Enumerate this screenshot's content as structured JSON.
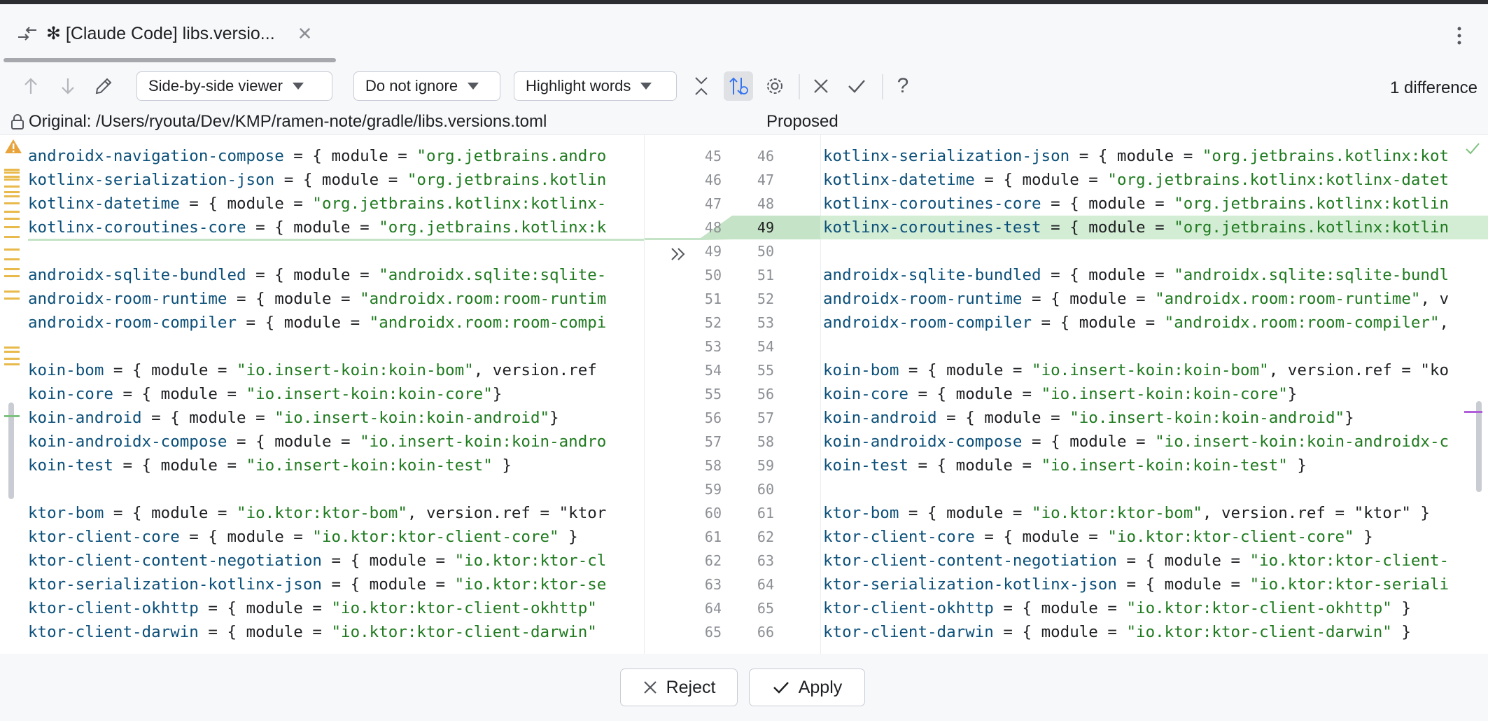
{
  "tab": {
    "title": "✻ [Claude Code] libs.versio..."
  },
  "toolbar": {
    "viewer_mode": "Side-by-side viewer",
    "ignore_mode": "Do not ignore",
    "highlight_mode": "Highlight words",
    "difference_count": "1 difference"
  },
  "panes": {
    "original_label": "Original: /Users/ryouta/Dev/KMP/ramen-note/gradle/libs.versions.toml",
    "proposed_label": "Proposed"
  },
  "left_lines": [
    {
      "ln": "45",
      "k": "androidx-navigation-compose",
      "m": " = { module = ",
      "s": "\"org.jetbrains.andro",
      "r": ""
    },
    {
      "ln": "46",
      "k": "kotlinx-serialization-json",
      "m": " = { module = ",
      "s": "\"org.jetbrains.kotlin",
      "r": ""
    },
    {
      "ln": "47",
      "k": "kotlinx-datetime",
      "m": " = { module = ",
      "s": "\"org.jetbrains.kotlinx:kotlinx-",
      "r": ""
    },
    {
      "ln": "48",
      "k": "kotlinx-coroutines-core",
      "m": " = { module = ",
      "s": "\"org.jetbrains.kotlinx:k",
      "r": ""
    },
    {
      "ln": "49",
      "k": "",
      "m": "",
      "s": "",
      "r": ""
    },
    {
      "ln": "50",
      "k": "androidx-sqlite-bundled",
      "m": " = { module = ",
      "s": "\"androidx.sqlite:sqlite-",
      "r": ""
    },
    {
      "ln": "51",
      "k": "androidx-room-runtime",
      "m": " = { module = ",
      "s": "\"androidx.room:room-runtim",
      "r": ""
    },
    {
      "ln": "52",
      "k": "androidx-room-compiler",
      "m": " = { module = ",
      "s": "\"androidx.room:room-compi",
      "r": ""
    },
    {
      "ln": "53",
      "k": "",
      "m": "",
      "s": "",
      "r": ""
    },
    {
      "ln": "54",
      "k": "koin-bom",
      "m": " = { module = ",
      "s": "\"io.insert-koin:koin-bom\"",
      "r": ", version.ref"
    },
    {
      "ln": "55",
      "k": "koin-core",
      "m": " = { module = ",
      "s": "\"io.insert-koin:koin-core\"",
      "r": "}"
    },
    {
      "ln": "56",
      "k": "koin-android",
      "m": " = { module = ",
      "s": "\"io.insert-koin:koin-android\"",
      "r": "}"
    },
    {
      "ln": "57",
      "k": "koin-androidx-compose",
      "m": " = { module = ",
      "s": "\"io.insert-koin:koin-andro",
      "r": ""
    },
    {
      "ln": "58",
      "k": "koin-test",
      "m": " = { module = ",
      "s": "\"io.insert-koin:koin-test\"",
      "r": " }"
    },
    {
      "ln": "59",
      "k": "",
      "m": "",
      "s": "",
      "r": ""
    },
    {
      "ln": "60",
      "k": "ktor-bom",
      "m": " = { module = ",
      "s": "\"io.ktor:ktor-bom\"",
      "r": ", version.ref = \"ktor"
    },
    {
      "ln": "61",
      "k": "ktor-client-core",
      "m": " = { module = ",
      "s": "\"io.ktor:ktor-client-core\"",
      "r": " }"
    },
    {
      "ln": "62",
      "k": "ktor-client-content-negotiation",
      "m": " = { module = ",
      "s": "\"io.ktor:ktor-cl",
      "r": ""
    },
    {
      "ln": "63",
      "k": "ktor-serialization-kotlinx-json",
      "m": " = { module = ",
      "s": "\"io.ktor:ktor-se",
      "r": ""
    },
    {
      "ln": "64",
      "k": "ktor-client-okhttp",
      "m": " = { module = ",
      "s": "\"io.ktor:ktor-client-okhttp\"",
      "r": ""
    },
    {
      "ln": "65",
      "k": "ktor-client-darwin",
      "m": " = { module = ",
      "s": "\"io.ktor:ktor-client-darwin\"",
      "r": ""
    }
  ],
  "right_lines": [
    {
      "ln": "46",
      "k": "kotlinx-serialization-json",
      "m": " = { module = ",
      "s": "\"org.jetbrains.kotlinx:kot",
      "r": ""
    },
    {
      "ln": "47",
      "k": "kotlinx-datetime",
      "m": " = { module = ",
      "s": "\"org.jetbrains.kotlinx:kotlinx-datet",
      "r": ""
    },
    {
      "ln": "48",
      "k": "kotlinx-coroutines-core",
      "m": " = { module = ",
      "s": "\"org.jetbrains.kotlinx:kotlin",
      "r": ""
    },
    {
      "ln": "49",
      "k": "kotlinx-coroutines-test",
      "m": " = { module = ",
      "s": "\"org.jetbrains.kotlinx:kotlin",
      "r": ""
    },
    {
      "ln": "50",
      "k": "",
      "m": "",
      "s": "",
      "r": ""
    },
    {
      "ln": "51",
      "k": "androidx-sqlite-bundled",
      "m": " = { module = ",
      "s": "\"androidx.sqlite:sqlite-bundl",
      "r": ""
    },
    {
      "ln": "52",
      "k": "androidx-room-runtime",
      "m": " = { module = ",
      "s": "\"androidx.room:room-runtime\"",
      "r": ", v"
    },
    {
      "ln": "53",
      "k": "androidx-room-compiler",
      "m": " = { module = ",
      "s": "\"androidx.room:room-compiler\"",
      "r": ","
    },
    {
      "ln": "54",
      "k": "",
      "m": "",
      "s": "",
      "r": ""
    },
    {
      "ln": "55",
      "k": "koin-bom",
      "m": " = { module = ",
      "s": "\"io.insert-koin:koin-bom\"",
      "r": ", version.ref = \"ko"
    },
    {
      "ln": "56",
      "k": "koin-core",
      "m": " = { module = ",
      "s": "\"io.insert-koin:koin-core\"",
      "r": "}"
    },
    {
      "ln": "57",
      "k": "koin-android",
      "m": " = { module = ",
      "s": "\"io.insert-koin:koin-android\"",
      "r": "}"
    },
    {
      "ln": "58",
      "k": "koin-androidx-compose",
      "m": " = { module = ",
      "s": "\"io.insert-koin:koin-androidx-c",
      "r": ""
    },
    {
      "ln": "59",
      "k": "koin-test",
      "m": " = { module = ",
      "s": "\"io.insert-koin:koin-test\"",
      "r": " }"
    },
    {
      "ln": "60",
      "k": "",
      "m": "",
      "s": "",
      "r": ""
    },
    {
      "ln": "61",
      "k": "ktor-bom",
      "m": " = { module = ",
      "s": "\"io.ktor:ktor-bom\"",
      "r": ", version.ref = \"ktor\" }"
    },
    {
      "ln": "62",
      "k": "ktor-client-core",
      "m": " = { module = ",
      "s": "\"io.ktor:ktor-client-core\"",
      "r": " }"
    },
    {
      "ln": "63",
      "k": "ktor-client-content-negotiation",
      "m": " = { module = ",
      "s": "\"io.ktor:ktor-client-",
      "r": ""
    },
    {
      "ln": "64",
      "k": "ktor-serialization-kotlinx-json",
      "m": " = { module = ",
      "s": "\"io.ktor:ktor-seriali",
      "r": ""
    },
    {
      "ln": "65",
      "k": "ktor-client-okhttp",
      "m": " = { module = ",
      "s": "\"io.ktor:ktor-client-okhttp\"",
      "r": " }"
    },
    {
      "ln": "66",
      "k": "ktor-client-darwin",
      "m": " = { module = ",
      "s": "\"io.ktor:ktor-client-darwin\"",
      "r": " }"
    }
  ],
  "footer": {
    "reject_label": "Reject",
    "apply_label": "Apply"
  },
  "colors": {
    "added_line": "#d3edd5",
    "accent": "#3574f0",
    "keyword": "#0b4f79",
    "string": "#1f7a1f"
  }
}
